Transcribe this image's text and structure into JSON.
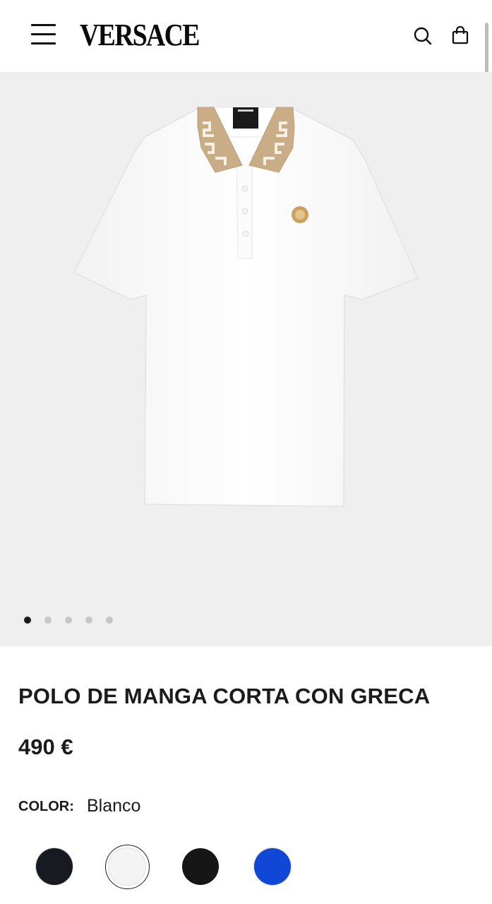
{
  "header": {
    "brand": "VERSACE",
    "menu_icon": "hamburger-menu-icon",
    "search_icon": "search-icon",
    "bag_icon": "shopping-bag-icon"
  },
  "gallery": {
    "image_alt": "white polo shirt with greca collar",
    "current_slide": 1,
    "total_slides": 5
  },
  "product": {
    "title": "POLO DE MANGA CORTA CON GRECA",
    "price": "490 €",
    "color_label": "COLOR:",
    "color_value": "Blanco",
    "swatches": [
      {
        "color": "#181a22",
        "selected": false
      },
      {
        "color": "#f4f4f4",
        "selected": true
      },
      {
        "color": "#161616",
        "selected": false
      },
      {
        "color": "#1047d6",
        "selected": false
      }
    ]
  },
  "colors": {
    "gallery_bg": "#efefef",
    "text": "#1b1b1b",
    "greca_gold": "#c8ad86"
  }
}
